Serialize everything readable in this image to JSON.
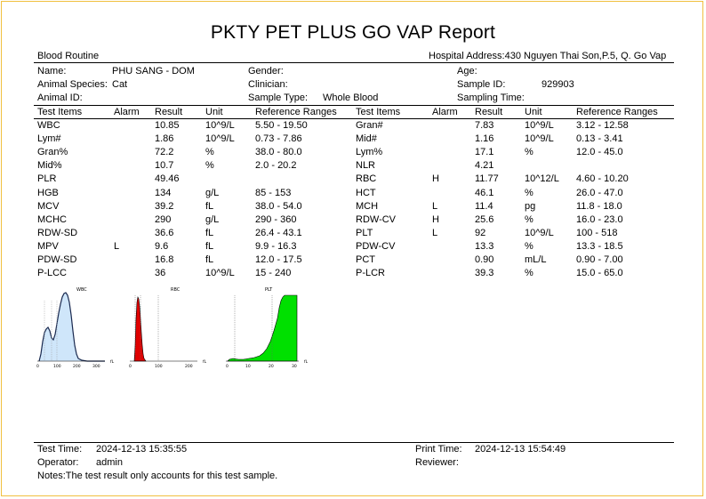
{
  "report": {
    "title": "PKTY PET PLUS GO VAP Report",
    "section": "Blood Routine",
    "hospital_address": "Hospital Address:430 Nguyen Thai Son,P.5, Q. Go Vap"
  },
  "patient": {
    "name_label": "Name:",
    "name_value": "PHU SANG - DOM",
    "gender_label": "Gender:",
    "age_label": "Age:",
    "species_label": "Animal Species:",
    "species_value": "Cat",
    "clinician_label": "Clinician:",
    "sample_id_label": "Sample ID:",
    "sample_id_value": "929903",
    "animal_id_label": "Animal ID:",
    "sample_type_label": "Sample Type:",
    "sample_type_value": "Whole Blood",
    "sampling_time_label": "Sampling Time:"
  },
  "columns": [
    "Test Items",
    "Alarm",
    "Result",
    "Unit",
    "Reference Ranges"
  ],
  "left_rows": [
    {
      "item": "WBC",
      "alarm": "",
      "result": "10.85",
      "unit": "10^9/L",
      "ref": "5.50 - 19.50"
    },
    {
      "item": "Lym#",
      "alarm": "",
      "result": "1.86",
      "unit": "10^9/L",
      "ref": "0.73 - 7.86"
    },
    {
      "item": "Gran%",
      "alarm": "",
      "result": "72.2",
      "unit": "%",
      "ref": "38.0 - 80.0"
    },
    {
      "item": "Mid%",
      "alarm": "",
      "result": "10.7",
      "unit": "%",
      "ref": "2.0 - 20.2"
    },
    {
      "item": "PLR",
      "alarm": "",
      "result": "49.46",
      "unit": "",
      "ref": ""
    },
    {
      "item": "HGB",
      "alarm": "",
      "result": "134",
      "unit": "g/L",
      "ref": "85 - 153"
    },
    {
      "item": "MCV",
      "alarm": "",
      "result": "39.2",
      "unit": "fL",
      "ref": "38.0 - 54.0"
    },
    {
      "item": "MCHC",
      "alarm": "",
      "result": "290",
      "unit": "g/L",
      "ref": "290 - 360"
    },
    {
      "item": "RDW-SD",
      "alarm": "",
      "result": "36.6",
      "unit": "fL",
      "ref": "26.4 - 43.1"
    },
    {
      "item": "MPV",
      "alarm": "L",
      "result": "9.6",
      "unit": "fL",
      "ref": "9.9 - 16.3"
    },
    {
      "item": "PDW-SD",
      "alarm": "",
      "result": "16.8",
      "unit": "fL",
      "ref": "12.0 - 17.5"
    },
    {
      "item": "P-LCC",
      "alarm": "",
      "result": "36",
      "unit": "10^9/L",
      "ref": "15 - 240"
    }
  ],
  "right_rows": [
    {
      "item": "Gran#",
      "alarm": "",
      "result": "7.83",
      "unit": "10^9/L",
      "ref": "3.12 - 12.58"
    },
    {
      "item": "Mid#",
      "alarm": "",
      "result": "1.16",
      "unit": "10^9/L",
      "ref": "0.13 - 3.41"
    },
    {
      "item": "Lym%",
      "alarm": "",
      "result": "17.1",
      "unit": "%",
      "ref": "12.0 - 45.0"
    },
    {
      "item": "NLR",
      "alarm": "",
      "result": "4.21",
      "unit": "",
      "ref": ""
    },
    {
      "item": "RBC",
      "alarm": "H",
      "result": "11.77",
      "unit": "10^12/L",
      "ref": "4.60 - 10.20"
    },
    {
      "item": "HCT",
      "alarm": "",
      "result": "46.1",
      "unit": "%",
      "ref": "26.0 - 47.0"
    },
    {
      "item": "MCH",
      "alarm": "L",
      "result": "11.4",
      "unit": "pg",
      "ref": "11.8 - 18.0"
    },
    {
      "item": "RDW-CV",
      "alarm": "H",
      "result": "25.6",
      "unit": "%",
      "ref": "16.0 - 23.0"
    },
    {
      "item": "PLT",
      "alarm": "L",
      "result": "92",
      "unit": "10^9/L",
      "ref": "100 - 518"
    },
    {
      "item": "PDW-CV",
      "alarm": "",
      "result": "13.3",
      "unit": "%",
      "ref": "13.3 - 18.5"
    },
    {
      "item": "PCT",
      "alarm": "",
      "result": "0.90",
      "unit": "mL/L",
      "ref": "0.90 - 7.00"
    },
    {
      "item": "P-LCR",
      "alarm": "",
      "result": "39.3",
      "unit": "%",
      "ref": "15.0 - 65.0"
    }
  ],
  "histograms": [
    {
      "label": "WBC",
      "ticks": [
        "0",
        "100",
        "200",
        "300"
      ],
      "unit": "fL",
      "color": "#cfe6fa"
    },
    {
      "label": "RBC",
      "ticks": [
        "0",
        "100",
        "200"
      ],
      "unit": "fL",
      "color": "#e00000"
    },
    {
      "label": "PLT",
      "ticks": [
        "0",
        "10",
        "20",
        "30"
      ],
      "unit": "fL",
      "color": "#00e000"
    }
  ],
  "footer": {
    "test_time_label": "Test Time:",
    "test_time_value": "2024-12-13 15:35:55",
    "print_time_label": "Print Time:",
    "print_time_value": "2024-12-13 15:54:49",
    "operator_label": "Operator:",
    "operator_value": "admin",
    "reviewer_label": "Reviewer:",
    "notes": "Notes:The test result only accounts for this test sample."
  }
}
